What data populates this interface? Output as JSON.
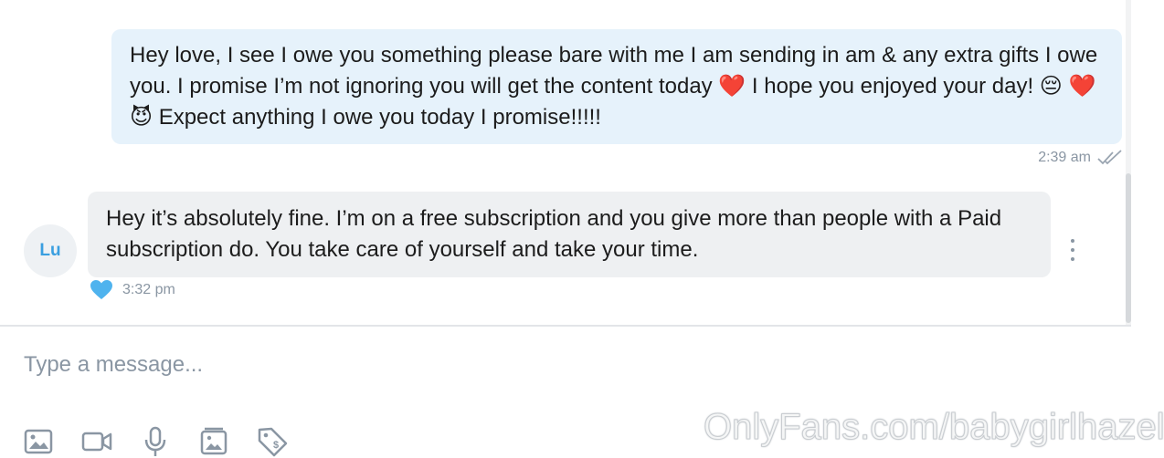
{
  "messages": {
    "outgoing": {
      "text": "Hey love, I see I owe you something please bare with me I am sending in am & any extra gifts I owe you. I promise I’m not ignoring you will get the content today ❤️  I hope you enjoyed your day! 😔 ❤️ 😈  Expect anything I owe you today I promise!!!!!",
      "time": "2:39 am",
      "status_icon": "double-check-icon"
    },
    "incoming": {
      "avatar_initials": "Lu",
      "text": "Hey it’s absolutely fine. I’m on a free subscription and you give more than people with a Paid subscription do. You take care of yourself and take your time.",
      "time": "3:32 pm",
      "reaction_icon": "heart-icon",
      "reaction_color": "#4fb3ee"
    }
  },
  "composer": {
    "placeholder": "Type a message...",
    "icons": [
      "image-icon",
      "video-icon",
      "microphone-icon",
      "media-vault-icon",
      "price-tag-icon"
    ]
  },
  "watermark": "OnlyFans.com/babygirlhazel",
  "colors": {
    "outgoing_bubble": "#e6f2fb",
    "incoming_bubble": "#eef0f2",
    "accent": "#3a9fe0",
    "muted": "#8a96a3"
  }
}
